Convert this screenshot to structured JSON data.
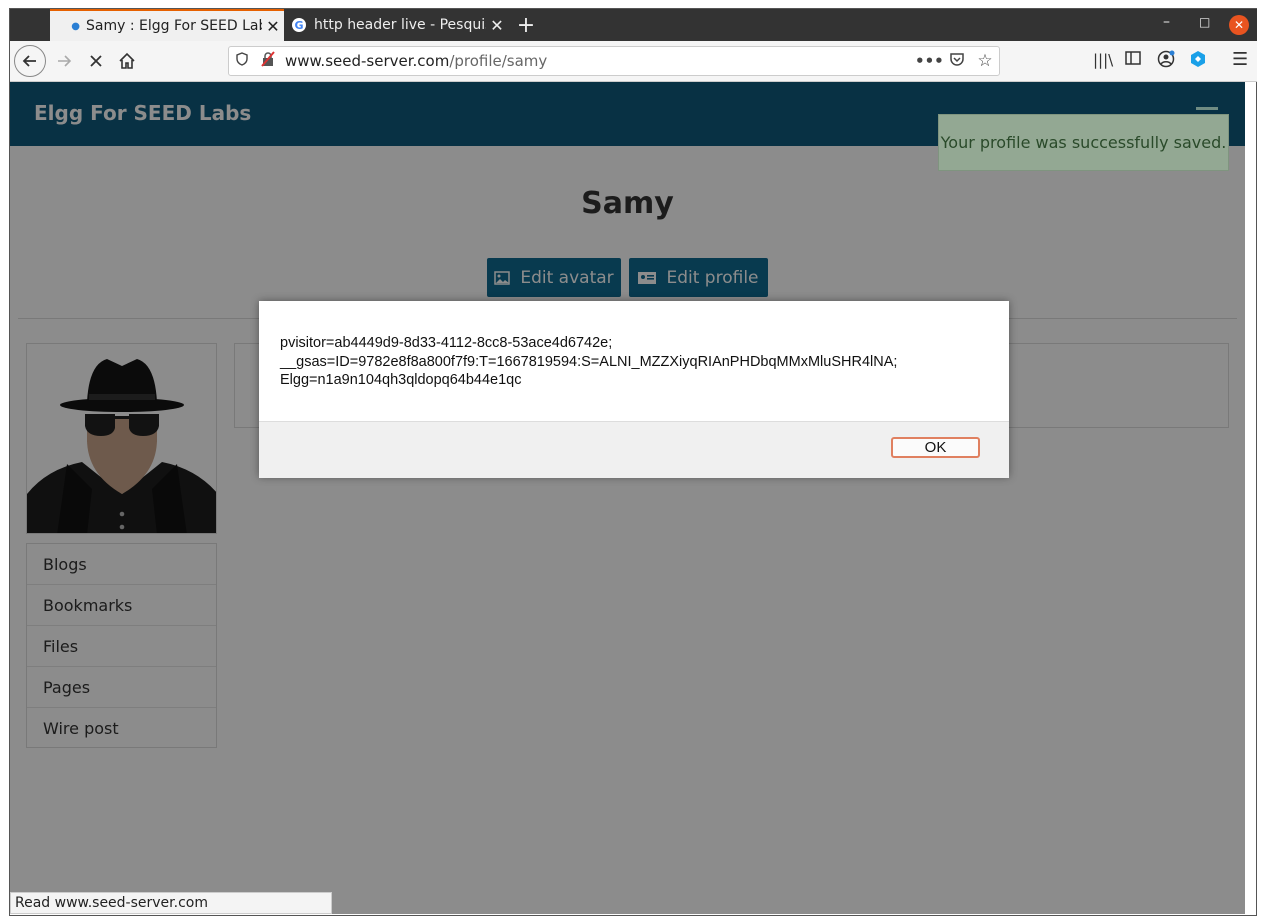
{
  "browser": {
    "tabs": [
      {
        "label": "Samy : Elgg For SEED Labs",
        "active": true
      },
      {
        "label": "http header live - Pesquisa",
        "active": false
      }
    ],
    "new_tab": "+",
    "url_host": "www.seed-server.com",
    "url_path": "/profile/samy",
    "status_text": "Read www.seed-server.com"
  },
  "site": {
    "title": "Elgg For SEED Labs",
    "flash_message": "Your profile was successfully saved.",
    "profile_name": "Samy",
    "edit_avatar_label": "Edit avatar",
    "edit_profile_label": "Edit profile",
    "menu": [
      "Blogs",
      "Bookmarks",
      "Files",
      "Pages",
      "Wire post"
    ]
  },
  "dialog": {
    "message": "pvisitor=ab4449d9-8d33-4112-8cc8-53ace4d6742e;\n__gsas=ID=9782e8f8a800f7f9:T=1667819594:S=ALNI_MZZXiyqRIAnPHDbqMMxMluSHR4lNA;\nElgg=n1a9n104qh3qldopq64b44e1qc",
    "ok_label": "OK"
  },
  "colors": {
    "topbar": "#0f5a7c",
    "button": "#0f6a90",
    "tab_accent": "#e66000"
  }
}
